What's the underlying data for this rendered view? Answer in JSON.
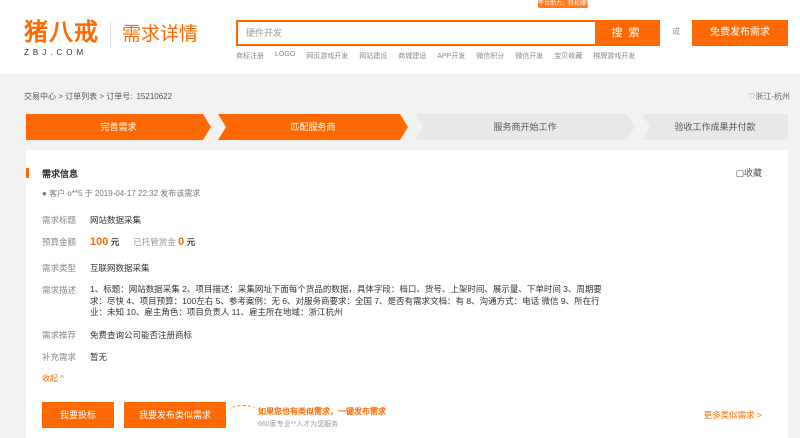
{
  "header": {
    "promo": "平台助力，轻松赚钱",
    "logo_text": "猪八戒",
    "logo_sub": "ZBJ.COM",
    "page_title": "需求详情",
    "search_placeholder": "硬件开发",
    "search_button": "搜索",
    "or_text": "或",
    "publish_button": "免费发布需求",
    "hot_links": [
      "商标注册",
      "LOGO",
      "网页游戏开发",
      "网站建设",
      "商城建设",
      "APP开发",
      "微信积分",
      "微信开发",
      "宝贝收藏",
      "棋牌游戏开发"
    ]
  },
  "breadcrumb": {
    "path": "交易中心 > 订单列表 > 订单号:",
    "order_number": "15210622",
    "location": "浙江-杭州"
  },
  "steps": [
    "完善需求",
    "匹配服务商",
    "服务商开始工作",
    "验收工作成果并付款"
  ],
  "card": {
    "title": "需求信息",
    "favorite": "收藏",
    "client": "客户 o**5 于 2019-04-17 22:32 发布该需求",
    "fields": {
      "title_label": "需求标题",
      "title_value": "网站数据采集",
      "budget_label": "预算金额",
      "budget_value": "100",
      "budget_unit": "元",
      "escrow_label": "已托管赏金",
      "escrow_value": "0",
      "escrow_unit": "元",
      "type_label": "需求类型",
      "type_value": "互联网数据采集",
      "desc_label": "需求描述",
      "desc_value": "1、标题：网站数据采集 2、项目描述：采集网址下面每个货品的数据，具体字段：档口、货号、上架时间、展示量、下单时间 3、周期要求：尽快 4、项目预算：100左右 5、参考案例：无 6、对服务商要求：全国 7、是否有需求文档：有 8、沟通方式：电话 微信 9、所在行业：未知 10、雇主角色：项目负责人 11、雇主所在地域：浙江杭州",
      "recommend_label": "需求推荐",
      "recommend_value": "免费查询公司能否注册商标",
      "extra_label": "补充需求",
      "extra_value": "暂无"
    },
    "collapse": "收起 ^",
    "bid_button": "我要投标",
    "similar_button": "我要发布类似需求",
    "hint_title": "如果您也有类似需求，一键发布需求",
    "hint_sub": "660家专业**人才为您服务",
    "more_link": "更多类似需求 >"
  },
  "colors": {
    "accent": "#ff6900",
    "link": "#3b82c4"
  }
}
